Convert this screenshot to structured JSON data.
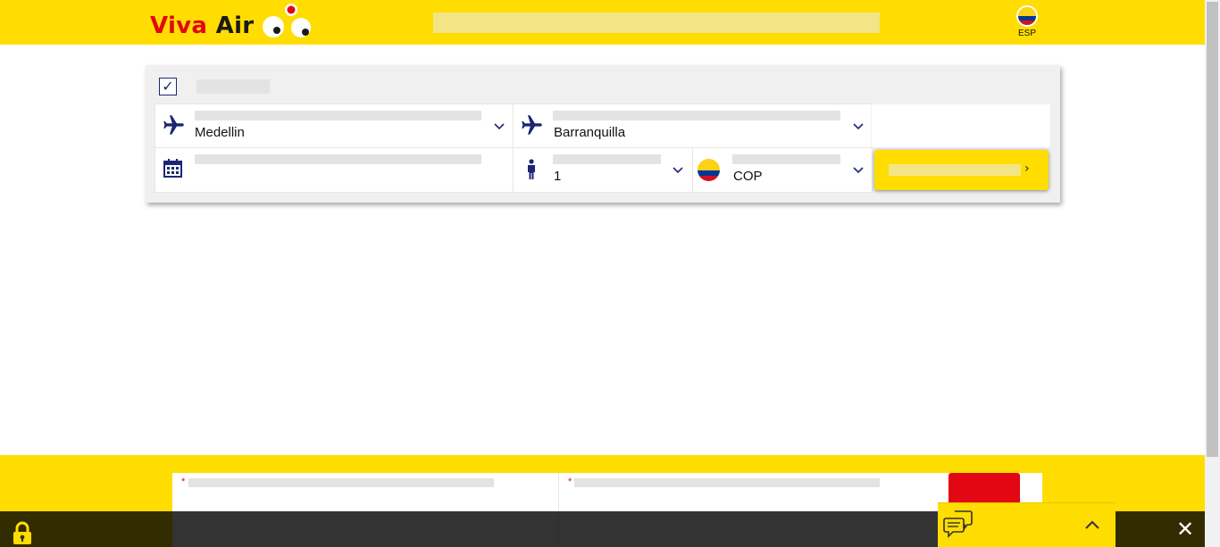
{
  "header": {
    "brand_part1": "Viva",
    "brand_part2": "Air",
    "language_label": "ESP"
  },
  "booking": {
    "origin_value": "Medellin",
    "destination_value": "Barranquilla",
    "passengers_value": "1",
    "currency_value": "COP",
    "search_arrow": "›"
  },
  "privacy": {
    "close_symbol": "✕"
  },
  "icons": {
    "checkbox": "checkmark-icon",
    "origin": "plane-icon",
    "destination": "plane-icon",
    "date": "calendar-icon",
    "passengers": "person-icon",
    "currency": "colombia-flag-icon",
    "lock": "lock-icon",
    "chat": "chat-icon"
  },
  "colors": {
    "brand_yellow": "#ffdd00",
    "brand_red": "#e30613",
    "icon_navy": "#1d2675"
  }
}
